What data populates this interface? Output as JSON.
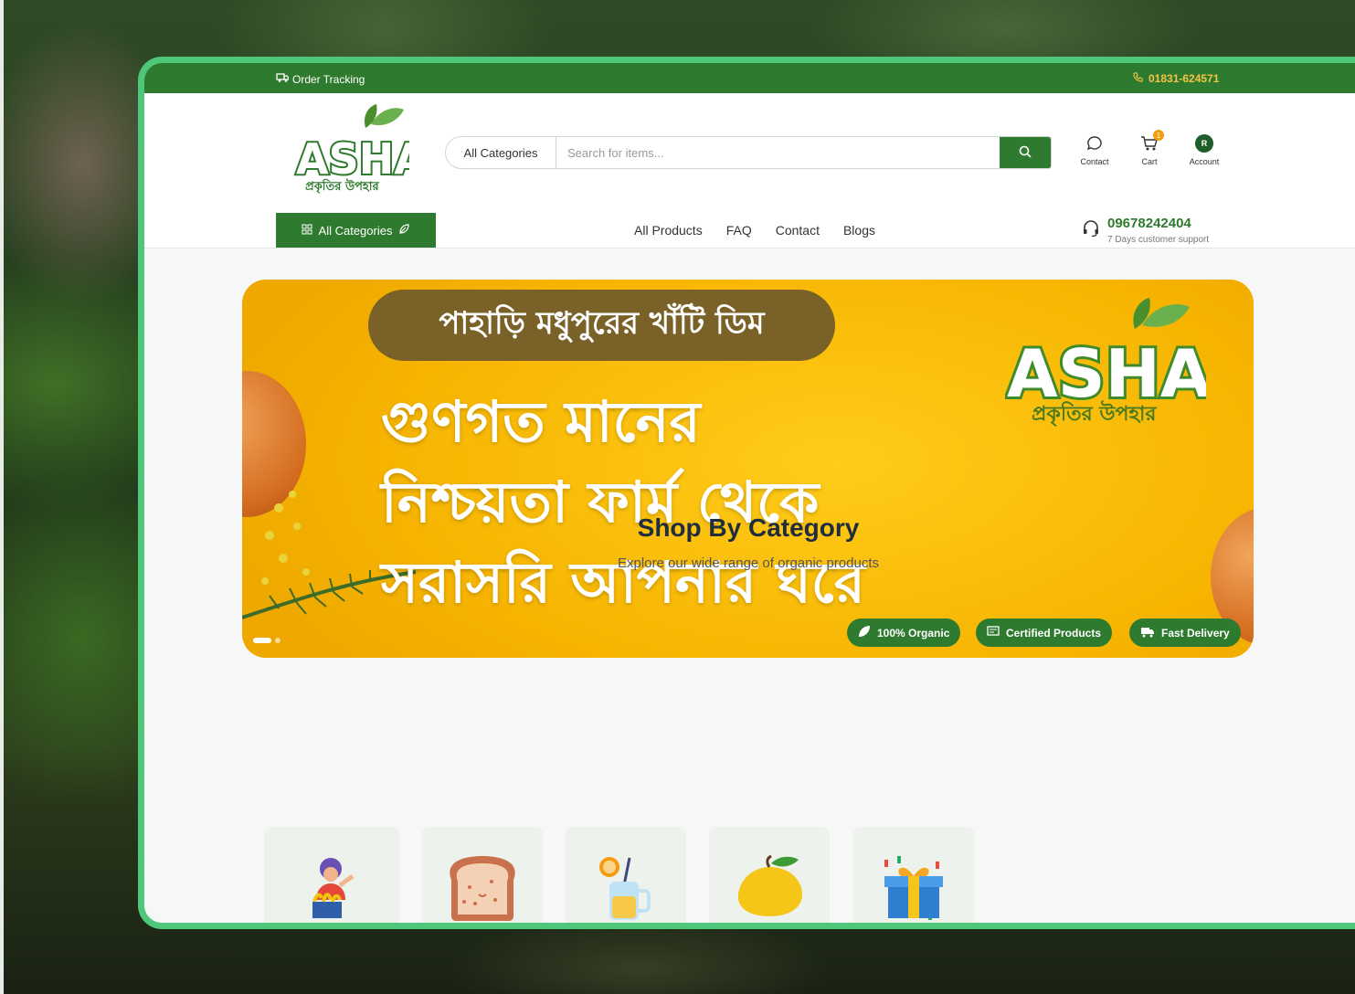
{
  "topbar": {
    "order_tracking": "Order Tracking",
    "phone": "01831-624571"
  },
  "header": {
    "logo_text": "ASHA",
    "logo_tagline": "প্রকৃতির উপহার",
    "search": {
      "category": "All Categories",
      "placeholder": "Search for items..."
    },
    "icons": {
      "contact": "Contact",
      "cart": "Cart",
      "cart_count": "1",
      "account": "Account",
      "account_initial": "R"
    },
    "all_categories_button": "All Categories",
    "nav": [
      "All Products",
      "FAQ",
      "Contact",
      "Blogs"
    ],
    "support": {
      "number": "09678242404",
      "subtitle": "7 Days customer support"
    }
  },
  "banner": {
    "pill_text": "পাহাড়ি মধুপুরের খাঁটি ডিম",
    "lines": [
      "গুণগত মানের",
      "নিশ্চয়তা ফার্ম থেকে",
      "সরাসরি আপনার ঘরে"
    ],
    "logo_text": "ASHA",
    "logo_tagline": "প্রকৃতির উপহার",
    "badges": [
      "100% Organic",
      "Certified Products",
      "Fast Delivery"
    ]
  },
  "shop": {
    "title": "Shop By Category",
    "subtitle": "Explore our wide range of organic products",
    "categories": [
      "vendor-icon",
      "bread-icon",
      "juice-icon",
      "mango-icon",
      "gift-box-icon"
    ]
  },
  "colors": {
    "primary_green": "#2e7a2e",
    "accent_yellow": "#f6c445",
    "frame_green": "#4fc77b",
    "banner_yellow": "#f6b400"
  }
}
